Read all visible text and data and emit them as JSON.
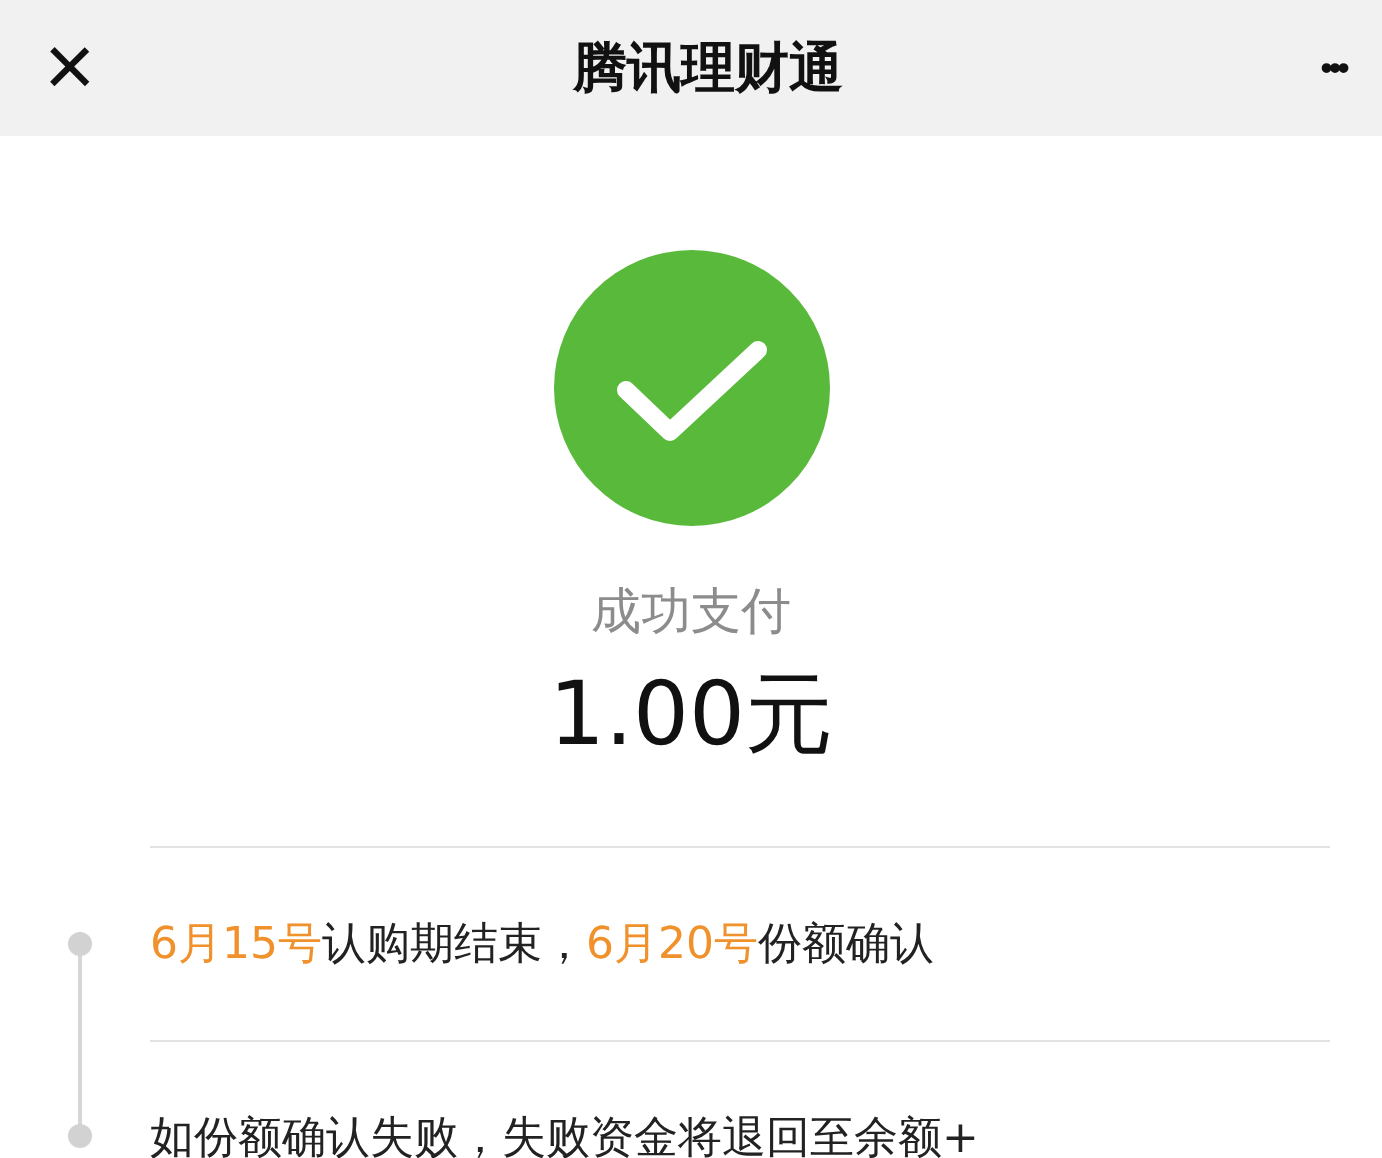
{
  "header": {
    "close": "×",
    "title": "腾讯理财通",
    "more": "•••"
  },
  "result": {
    "status": "成功支付",
    "amount": "1.00元"
  },
  "timeline": [
    {
      "segments": [
        {
          "text": "6月15号",
          "highlight": true
        },
        {
          "text": "认购期结束，",
          "highlight": false
        },
        {
          "text": "6月20号",
          "highlight": true
        },
        {
          "text": "份额确认",
          "highlight": false
        }
      ]
    },
    {
      "segments": [
        {
          "text": "如份额确认失败，失败资金将退回至余额+",
          "highlight": false
        }
      ]
    }
  ]
}
